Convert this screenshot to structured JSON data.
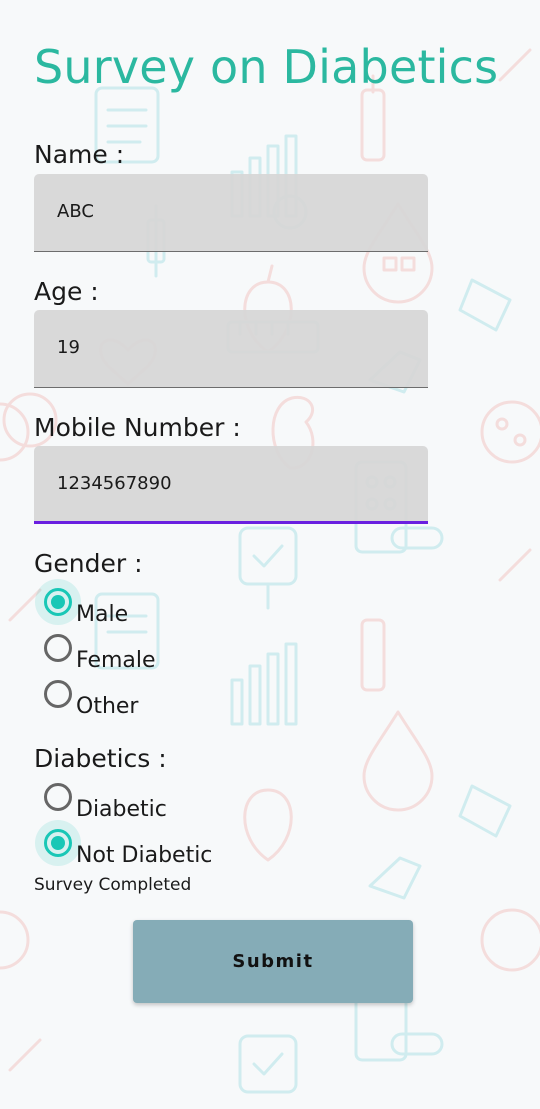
{
  "header": {
    "title": "Survey on Diabetics"
  },
  "form": {
    "name": {
      "label": "Name :",
      "value": "ABC"
    },
    "age": {
      "label": "Age :",
      "value": "19"
    },
    "mobile": {
      "label": "Mobile Number :",
      "value": "1234567890"
    },
    "gender": {
      "label": "Gender :",
      "options": [
        "Male",
        "Female",
        "Other"
      ],
      "selected": "Male"
    },
    "diabetics": {
      "label": "Diabetics :",
      "options": [
        "Diabetic",
        "Not Diabetic"
      ],
      "selected": "Not Diabetic"
    },
    "status_text": "Survey Completed",
    "submit_label": "Submit"
  },
  "colors": {
    "title": "#2bb8a0",
    "radio_checked": "#19c7b6",
    "focus_underline": "#6a1fe0",
    "submit_bg": "#85acb7",
    "field_bg": "#d6d6d6",
    "bg_pattern_teal": "#7fd3d9",
    "bg_pattern_red": "#f0a3a0"
  },
  "background": {
    "icons": [
      "medical-clipboard-icon",
      "bar-chart-icon",
      "blood-drop-icon",
      "syringe-icon",
      "apple-icon",
      "measuring-tape-icon",
      "heart-stethoscope-icon",
      "pill-pack-icon",
      "glucometer-icon",
      "cells-petri-dish-icon",
      "hand-icon",
      "kidney-icon"
    ]
  }
}
